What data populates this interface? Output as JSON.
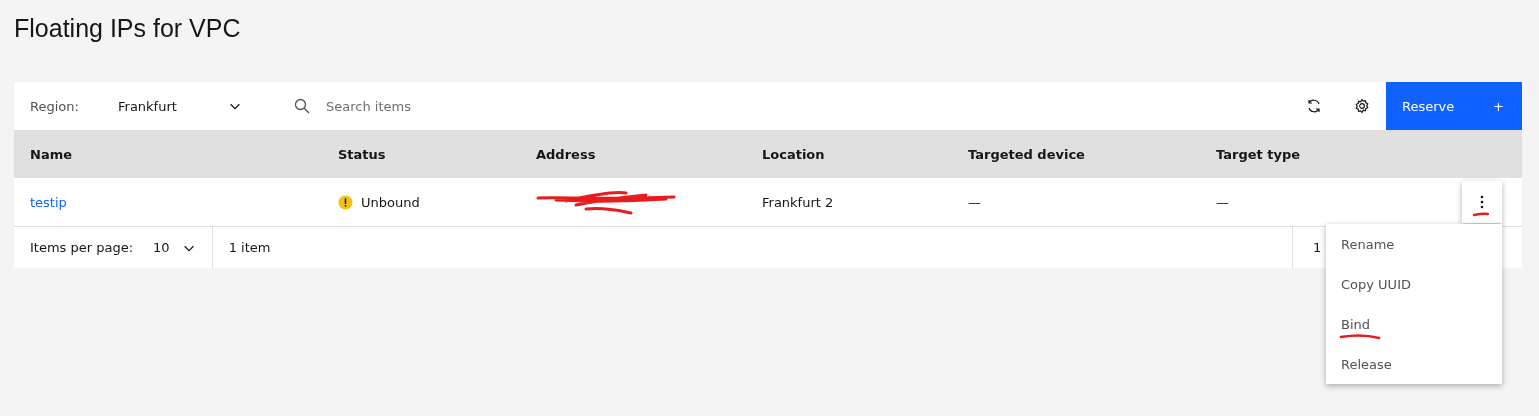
{
  "title": "Floating IPs for VPC",
  "toolbar": {
    "region_label": "Region:",
    "region_value": "Frankfurt",
    "search": {
      "placeholder": "Search items"
    },
    "primary_button": {
      "label": "Reserve",
      "icon_text": "+"
    }
  },
  "table": {
    "columns": [
      "Name",
      "Status",
      "Address",
      "Location",
      "Targeted device",
      "Target type"
    ],
    "rows": [
      {
        "name": "testip",
        "status": {
          "kind": "warning",
          "label": "Unbound"
        },
        "address_redacted": true,
        "location": "Frankfurt 2",
        "targeted_device": "—",
        "target_type": "—",
        "menu_open": true,
        "menu_button_annotated": true
      }
    ]
  },
  "pagination": {
    "items_per_page_label": "Items per page:",
    "items_per_page_value": "10",
    "item_count": "1 item",
    "page": "1"
  },
  "overflow_menu": {
    "items": [
      {
        "label": "Rename",
        "annotated": false
      },
      {
        "label": "Copy UUID",
        "annotated": false
      },
      {
        "label": "Bind",
        "annotated": true
      },
      {
        "label": "Release",
        "annotated": false
      }
    ]
  }
}
